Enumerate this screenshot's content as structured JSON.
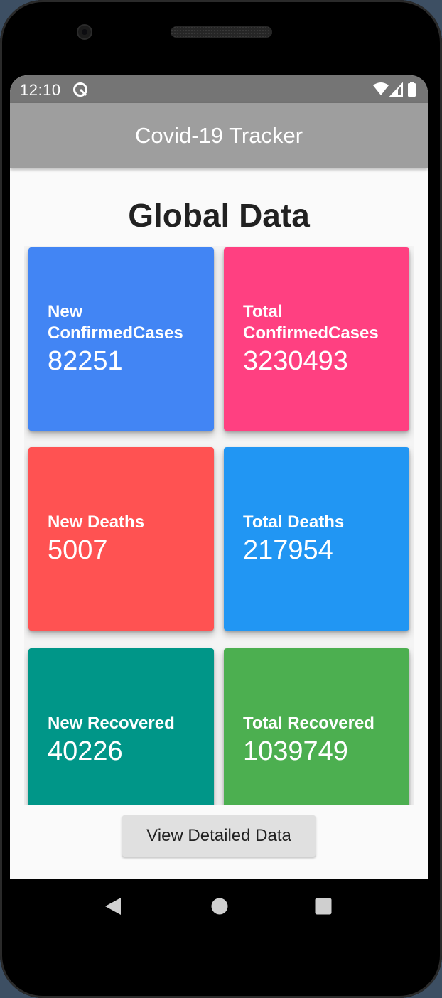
{
  "statusbar": {
    "time": "12:10"
  },
  "appbar": {
    "title": "Covid-19 Tracker"
  },
  "main": {
    "heading": "Global Data",
    "cards": [
      {
        "label": "New ConfirmedCases",
        "value": "82251",
        "color": "#4285f4"
      },
      {
        "label": "Total ConfirmedCases",
        "value": "3230493",
        "color": "#ff4081"
      },
      {
        "label": "New Deaths",
        "value": "5007",
        "color": "#ff5252"
      },
      {
        "label": "Total Deaths",
        "value": "217954",
        "color": "#2196f3"
      },
      {
        "label": "New Recovered",
        "value": "40226",
        "color": "#009688"
      },
      {
        "label": "Total Recovered",
        "value": "1039749",
        "color": "#4caf50"
      }
    ],
    "button_label": "View Detailed Data"
  },
  "icons": {
    "statusbar": [
      "data-saver-icon",
      "wifi-icon",
      "cell-signal-icon",
      "battery-icon"
    ],
    "navbar": [
      "back-icon",
      "home-icon",
      "recents-icon"
    ]
  },
  "colors": {
    "statusbar": "#757575",
    "appbar": "#9e9e9e",
    "background": "#fafafa",
    "button": "#e0e0e0"
  }
}
